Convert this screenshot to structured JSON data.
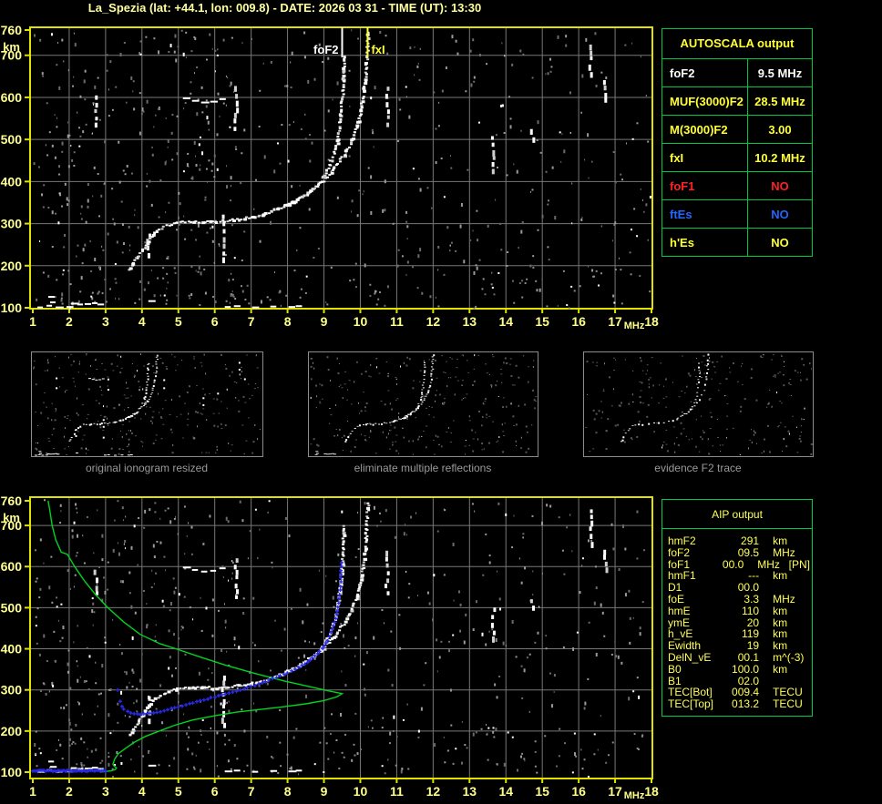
{
  "title": "La_Spezia (lat: +44.1, lon: 009.8) - DATE: 2026 03 31 - TIME (UT): 13:30",
  "autoscala": {
    "header": "AUTOSCALA output",
    "rows": [
      {
        "label": "foF2",
        "value": "9.5 MHz",
        "color": "#ffffff"
      },
      {
        "label": "MUF(3000)F2",
        "value": "28.5 MHz",
        "color": "#ffff33"
      },
      {
        "label": "M(3000)F2",
        "value": "3.00",
        "color": "#ffff33"
      },
      {
        "label": "fxI",
        "value": "10.2 MHz",
        "color": "#ffff33"
      },
      {
        "label": "foF1",
        "value": "NO",
        "color": "#ff2222"
      },
      {
        "label": "ftEs",
        "value": "NO",
        "color": "#2465ff"
      },
      {
        "label": "h'Es",
        "value": "NO",
        "color": "#ffff33"
      }
    ]
  },
  "aip": {
    "header": "AIP output",
    "rows": [
      {
        "label": "hmF2",
        "value": "291",
        "unit": "km",
        "note": ""
      },
      {
        "label": "foF2",
        "value": "09.5",
        "unit": "MHz",
        "note": ""
      },
      {
        "label": "foF1",
        "value": "00.0",
        "unit": "MHz",
        "note": "[PN]"
      },
      {
        "label": "hmF1",
        "value": "---",
        "unit": "km",
        "note": ""
      },
      {
        "label": "D1",
        "value": "00.0",
        "unit": "",
        "note": ""
      },
      {
        "label": "foE",
        "value": "3.3",
        "unit": "MHz",
        "note": ""
      },
      {
        "label": "hmE",
        "value": "110",
        "unit": "km",
        "note": ""
      },
      {
        "label": "ymE",
        "value": "20",
        "unit": "km",
        "note": ""
      },
      {
        "label": "h_vE",
        "value": "119",
        "unit": "km",
        "note": ""
      },
      {
        "label": "Ewidth",
        "value": "19",
        "unit": "km",
        "note": ""
      },
      {
        "label": "DelN_vE",
        "value": "00.1",
        "unit": "m^(-3)",
        "note": ""
      },
      {
        "label": "B0",
        "value": "100.0",
        "unit": "km",
        "note": ""
      },
      {
        "label": "B1",
        "value": "02.0",
        "unit": "",
        "note": ""
      },
      {
        "label": "TEC[Bot]",
        "value": "009.4",
        "unit": "TECU",
        "note": ""
      },
      {
        "label": "TEC[Top]",
        "value": "013.2",
        "unit": "TECU",
        "note": ""
      }
    ]
  },
  "thumbnails": [
    {
      "caption": "original ionogram resized"
    },
    {
      "caption": "eliminate multiple reflections"
    },
    {
      "caption": "evidence F2 trace"
    }
  ],
  "chart_data": {
    "type": "scatter",
    "title": "ionogram (echo virtual height vs sounding frequency)",
    "xlabel": "MHz",
    "ylabel": "km",
    "xlim": [
      1,
      18
    ],
    "ylim": [
      100,
      760
    ],
    "x_ticks": [
      "1",
      "2",
      "3",
      "4",
      "5",
      "6",
      "7",
      "8",
      "9",
      "10",
      "11",
      "12",
      "13",
      "14",
      "15",
      "16",
      "17",
      "18"
    ],
    "y_ticks": [
      "760",
      "700",
      "600",
      "500",
      "400",
      "300",
      "200",
      "100"
    ],
    "x_unit": "MHz",
    "y_unit": "km",
    "markers": {
      "foF2": {
        "label": "foF2",
        "f": 9.5,
        "color": "#ffffff"
      },
      "fxI": {
        "label": "fxI",
        "f": 10.2,
        "color": "#ffff33"
      }
    },
    "o_trace": [
      [
        3.62,
        192
      ],
      [
        3.72,
        205
      ],
      [
        3.85,
        222
      ],
      [
        4.0,
        242
      ],
      [
        4.15,
        262
      ],
      [
        4.3,
        278
      ],
      [
        4.5,
        291
      ],
      [
        4.7,
        299
      ],
      [
        4.95,
        304
      ],
      [
        5.3,
        306
      ],
      [
        5.7,
        307
      ],
      [
        6.1,
        308
      ],
      [
        6.5,
        311
      ],
      [
        6.9,
        316
      ],
      [
        7.2,
        322
      ],
      [
        7.5,
        330
      ],
      [
        7.8,
        340
      ],
      [
        8.1,
        352
      ],
      [
        8.4,
        367
      ],
      [
        8.65,
        383
      ],
      [
        8.85,
        400
      ],
      [
        9.0,
        418
      ],
      [
        9.12,
        438
      ],
      [
        9.22,
        460
      ],
      [
        9.3,
        484
      ],
      [
        9.36,
        510
      ],
      [
        9.41,
        540
      ],
      [
        9.45,
        575
      ],
      [
        9.48,
        615
      ],
      [
        9.5,
        655
      ],
      [
        9.52,
        700
      ]
    ],
    "x_trace": [
      [
        7.9,
        345
      ],
      [
        8.2,
        357
      ],
      [
        8.5,
        372
      ],
      [
        8.75,
        388
      ],
      [
        8.95,
        404
      ],
      [
        9.15,
        422
      ],
      [
        9.35,
        444
      ],
      [
        9.55,
        468
      ],
      [
        9.72,
        495
      ],
      [
        9.85,
        525
      ],
      [
        9.95,
        558
      ],
      [
        10.03,
        595
      ],
      [
        10.09,
        635
      ],
      [
        10.13,
        678
      ],
      [
        10.16,
        720
      ],
      [
        10.18,
        755
      ]
    ],
    "e_trace_marks": [
      [
        2.12,
        112
      ],
      [
        2.3,
        110
      ],
      [
        2.5,
        111
      ],
      [
        2.7,
        113
      ],
      [
        2.85,
        110
      ],
      [
        1.5,
        128
      ],
      [
        1.55,
        115
      ],
      [
        1.45,
        107
      ],
      [
        6.35,
        104
      ],
      [
        6.6,
        106
      ],
      [
        7.1,
        103
      ],
      [
        7.6,
        105
      ],
      [
        8.1,
        104
      ],
      [
        8.3,
        106
      ],
      [
        4.25,
        118
      ],
      [
        5.2,
        600
      ],
      [
        5.45,
        594
      ],
      [
        5.7,
        590
      ],
      [
        5.95,
        592
      ],
      [
        6.2,
        598
      ],
      [
        1.2,
        103
      ],
      [
        1.7,
        103
      ],
      [
        2.0,
        104
      ]
    ],
    "noise_clusters": [
      [
        2.7,
        540,
        610
      ],
      [
        6.2,
        220,
        340
      ],
      [
        6.55,
        530,
        635
      ],
      [
        10.7,
        540,
        645
      ],
      [
        16.3,
        660,
        742
      ],
      [
        16.7,
        598,
        645
      ],
      [
        4.15,
        230,
        290
      ],
      [
        13.62,
        430,
        510
      ],
      [
        14.7,
        505,
        525
      ]
    ],
    "profile": [
      [
        1.42,
        760
      ],
      [
        1.47,
        735
      ],
      [
        1.53,
        700
      ],
      [
        1.63,
        665
      ],
      [
        1.78,
        635
      ],
      [
        1.95,
        630
      ],
      [
        2.15,
        600
      ],
      [
        2.42,
        565
      ],
      [
        2.72,
        532
      ],
      [
        3.06,
        500
      ],
      [
        3.5,
        465
      ],
      [
        3.95,
        435
      ],
      [
        4.5,
        412
      ],
      [
        4.93,
        400
      ],
      [
        5.6,
        380
      ],
      [
        6.3,
        360
      ],
      [
        7.1,
        340
      ],
      [
        7.9,
        322
      ],
      [
        8.6,
        308
      ],
      [
        9.1,
        298
      ],
      [
        9.4,
        293
      ],
      [
        9.5,
        291
      ],
      [
        9.35,
        283
      ],
      [
        9.0,
        274
      ],
      [
        8.5,
        266
      ],
      [
        7.8,
        258
      ],
      [
        7.1,
        251
      ],
      [
        6.6,
        246
      ],
      [
        6.0,
        237
      ],
      [
        5.4,
        227
      ],
      [
        4.9,
        214
      ],
      [
        4.48,
        200
      ],
      [
        4.1,
        187
      ],
      [
        3.8,
        173
      ],
      [
        3.55,
        158
      ],
      [
        3.35,
        145
      ],
      [
        3.25,
        132
      ],
      [
        3.2,
        119
      ],
      [
        3.23,
        115
      ],
      [
        3.3,
        110
      ],
      [
        3.26,
        106
      ],
      [
        3.15,
        103
      ],
      [
        2.95,
        101
      ],
      [
        2.86,
        100
      ]
    ],
    "restored_trace": {
      "e_segment": {
        "f0": 1.0,
        "f1": 3.0,
        "km": 103
      },
      "f_points": [
        [
          3.5,
          253
        ],
        [
          3.62,
          247
        ],
        [
          3.78,
          242
        ],
        [
          3.95,
          240
        ],
        [
          4.15,
          242
        ],
        [
          4.4,
          246
        ],
        [
          4.7,
          252
        ],
        [
          5.0,
          259
        ],
        [
          5.3,
          266
        ],
        [
          5.6,
          273
        ],
        [
          5.9,
          281
        ],
        [
          6.2,
          288
        ],
        [
          6.5,
          295
        ],
        [
          6.8,
          303
        ],
        [
          7.1,
          311
        ],
        [
          7.4,
          320
        ],
        [
          7.7,
          330
        ],
        [
          8.0,
          341
        ],
        [
          8.3,
          355
        ],
        [
          8.55,
          368
        ],
        [
          8.75,
          382
        ],
        [
          8.95,
          400
        ],
        [
          9.1,
          420
        ],
        [
          9.2,
          440
        ],
        [
          9.3,
          465
        ],
        [
          9.37,
          492
        ],
        [
          9.42,
          522
        ],
        [
          9.45,
          552
        ],
        [
          9.47,
          582
        ],
        [
          9.48,
          608
        ]
      ],
      "isolated": [
        [
          3.33,
          300
        ],
        [
          3.4,
          272
        ],
        [
          3.45,
          260
        ]
      ]
    },
    "colors": {
      "frame": "#e2e200",
      "axis_label": "#ffff8c",
      "grid": "#787878",
      "trace": "#ffffff",
      "profile_green": "#00d41e",
      "restored_blue": "#2a2aee",
      "table_border": "#00c83c",
      "noise_gray": "#9a9a9a"
    },
    "legend_position": "none",
    "grid": true
  }
}
